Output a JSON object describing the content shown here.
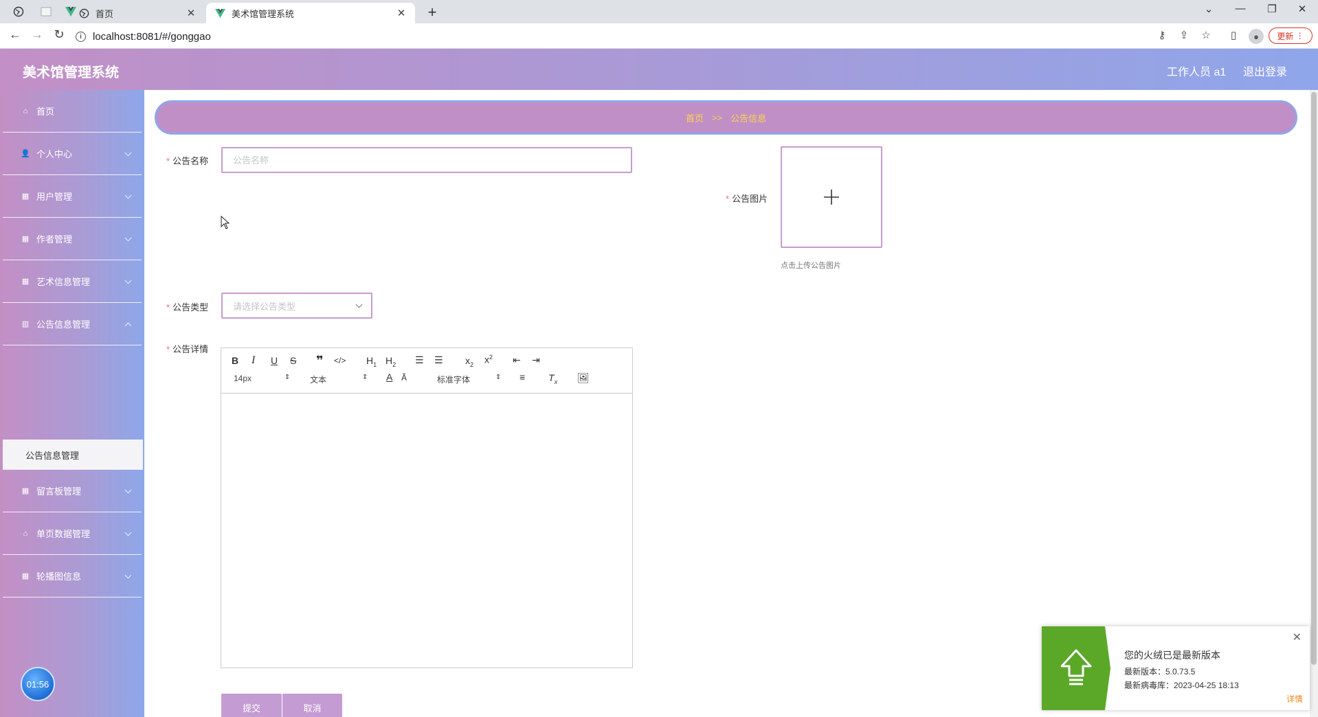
{
  "browser": {
    "tabs": [
      {
        "title": "首页"
      },
      {
        "title": "美术馆管理系统"
      }
    ],
    "url": "localhost:8081/#/gonggao",
    "update_label": "更新"
  },
  "header": {
    "title": "美术馆管理系统",
    "user": "工作人员 a1",
    "logout": "退出登录"
  },
  "sidebar": {
    "items": [
      {
        "label": "首页",
        "icon": "home-icon"
      },
      {
        "label": "个人中心",
        "icon": "person-icon"
      },
      {
        "label": "用户管理",
        "icon": "grid-icon"
      },
      {
        "label": "作者管理",
        "icon": "grid-icon"
      },
      {
        "label": "艺术信息管理",
        "icon": "grid-icon"
      },
      {
        "label": "公告信息管理",
        "icon": "chart-icon"
      },
      {
        "label": "留言板管理",
        "icon": "grid-icon"
      },
      {
        "label": "单页数据管理",
        "icon": "bank-icon"
      },
      {
        "label": "轮播图信息",
        "icon": "grid-icon"
      }
    ],
    "active_sub": "公告信息管理",
    "clock": "01:56"
  },
  "breadcrumb": {
    "home": "首页",
    "sep": ">>",
    "current": "公告信息"
  },
  "form": {
    "name_label": "公告名称",
    "name_placeholder": "公告名称",
    "image_label": "公告图片",
    "upload_tip": "点击上传公告图片",
    "type_label": "公告类型",
    "type_placeholder": "请选择公告类型",
    "detail_label": "公告详情",
    "submit": "提交",
    "cancel": "取消"
  },
  "editor": {
    "font_size": "14px",
    "header_select": "文本",
    "font_family": "标准字体"
  },
  "notification": {
    "title": "您的火绒已是最新版本",
    "version": "最新版本：5.0.73.5",
    "virus_db": "最新病毒库：2023-04-25 18:13",
    "detail": "详情"
  },
  "colors": {
    "accent": "#c08fc6",
    "accent_blue": "#8fa6ea",
    "breadcrumb_text": "#ffd24a",
    "required": "#f56c6c"
  }
}
